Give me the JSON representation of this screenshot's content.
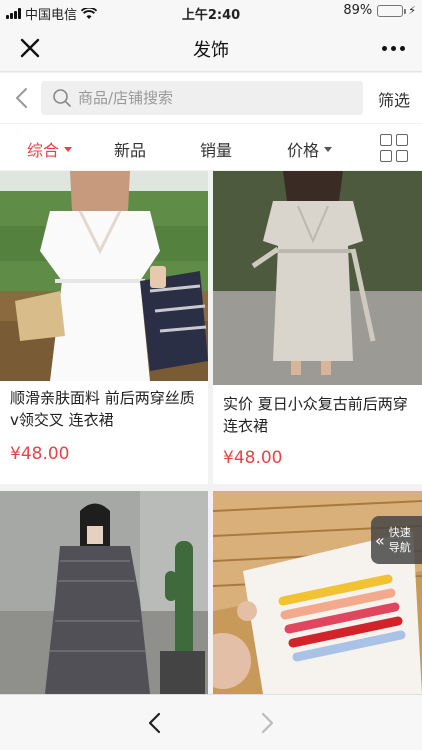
{
  "status_bar": {
    "carrier": "中国电信",
    "time": "上午2:40",
    "battery_percent": "89%",
    "battery_level": 0.89
  },
  "nav": {
    "title": "发饰",
    "close_icon": "close-icon",
    "more_icon": "more-icon"
  },
  "search": {
    "placeholder": "商品/店铺搜索",
    "value": "",
    "filter_label": "筛选"
  },
  "sort_tabs": [
    {
      "label": "综合",
      "active": true,
      "has_caret": true
    },
    {
      "label": "新品",
      "active": false,
      "has_caret": false
    },
    {
      "label": "销量",
      "active": false,
      "has_caret": false
    },
    {
      "label": "价格",
      "active": false,
      "has_caret": true
    }
  ],
  "products": [
    {
      "name": "顺滑亲肤面料 前后两穿丝质v领交叉 连衣裙",
      "price": "¥48.00",
      "image": "white-wrap-dress-photo"
    },
    {
      "name": "实价 夏日小众复古前后两穿连衣裙",
      "price": "¥48.00",
      "image": "grey-linen-dress-photo"
    },
    {
      "name": "",
      "price": "",
      "image": "black-gingham-dress-photo"
    },
    {
      "name": "",
      "price": "",
      "image": "beaded-hair-clips-photo"
    }
  ],
  "quick_nav": {
    "label": "快速导航"
  },
  "bottom_bar": {
    "back_icon": "back-chevron-icon",
    "forward_icon": "forward-chevron-icon"
  },
  "colors": {
    "accent": "#e5454a",
    "battery": "#4cd964"
  }
}
